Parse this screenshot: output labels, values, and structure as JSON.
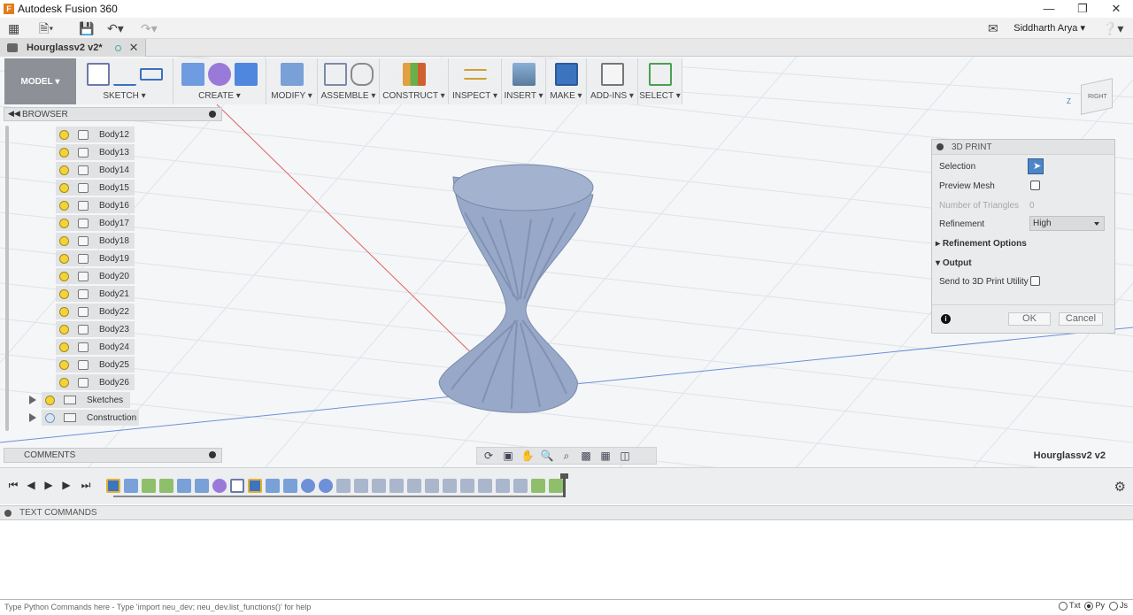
{
  "window": {
    "title": "Autodesk Fusion 360"
  },
  "menubar": {
    "user_name": "Siddharth Arya"
  },
  "tab": {
    "doc_name": "Hourglassv2 v2*"
  },
  "toolbar": {
    "workspace": "MODEL",
    "groups": [
      {
        "label": "SKETCH"
      },
      {
        "label": "CREATE"
      },
      {
        "label": "MODIFY"
      },
      {
        "label": "ASSEMBLE"
      },
      {
        "label": "CONSTRUCT"
      },
      {
        "label": "INSPECT"
      },
      {
        "label": "INSERT"
      },
      {
        "label": "MAKE"
      },
      {
        "label": "ADD-INS"
      },
      {
        "label": "SELECT"
      }
    ]
  },
  "browser": {
    "title": "BROWSER",
    "bodies": [
      "Body12",
      "Body13",
      "Body14",
      "Body15",
      "Body16",
      "Body17",
      "Body18",
      "Body19",
      "Body20",
      "Body21",
      "Body22",
      "Body23",
      "Body24",
      "Body25",
      "Body26"
    ],
    "folders": [
      "Sketches",
      "Construction"
    ]
  },
  "comments": {
    "title": "COMMENTS"
  },
  "viewcube": {
    "face": "RIGHT",
    "axis_z": "Z"
  },
  "dialog": {
    "title": "3D PRINT",
    "selection_label": "Selection",
    "preview_mesh_label": "Preview Mesh",
    "num_triangles_label": "Number of Triangles",
    "num_triangles_value": "0",
    "refinement_label": "Refinement",
    "refinement_value": "High",
    "refinement_options_label": "Refinement Options",
    "output_label": "Output",
    "send_label": "Send to 3D Print Utility",
    "ok_label": "OK",
    "cancel_label": "Cancel"
  },
  "viewport": {
    "doc_label": "Hourglassv2 v2"
  },
  "text_commands": {
    "title": "TEXT COMMANDS",
    "input_placeholder": "Type Python Commands here - Type 'import neu_dev; neu_dev.list_functions()' for help",
    "modes": [
      "Txt",
      "Py",
      "Js"
    ],
    "selected_mode": "Py"
  },
  "colors": {
    "model_accent": "#8f9ab8",
    "highlight_blue": "#4d86c7",
    "bulb_yellow": "#f2d43a"
  }
}
